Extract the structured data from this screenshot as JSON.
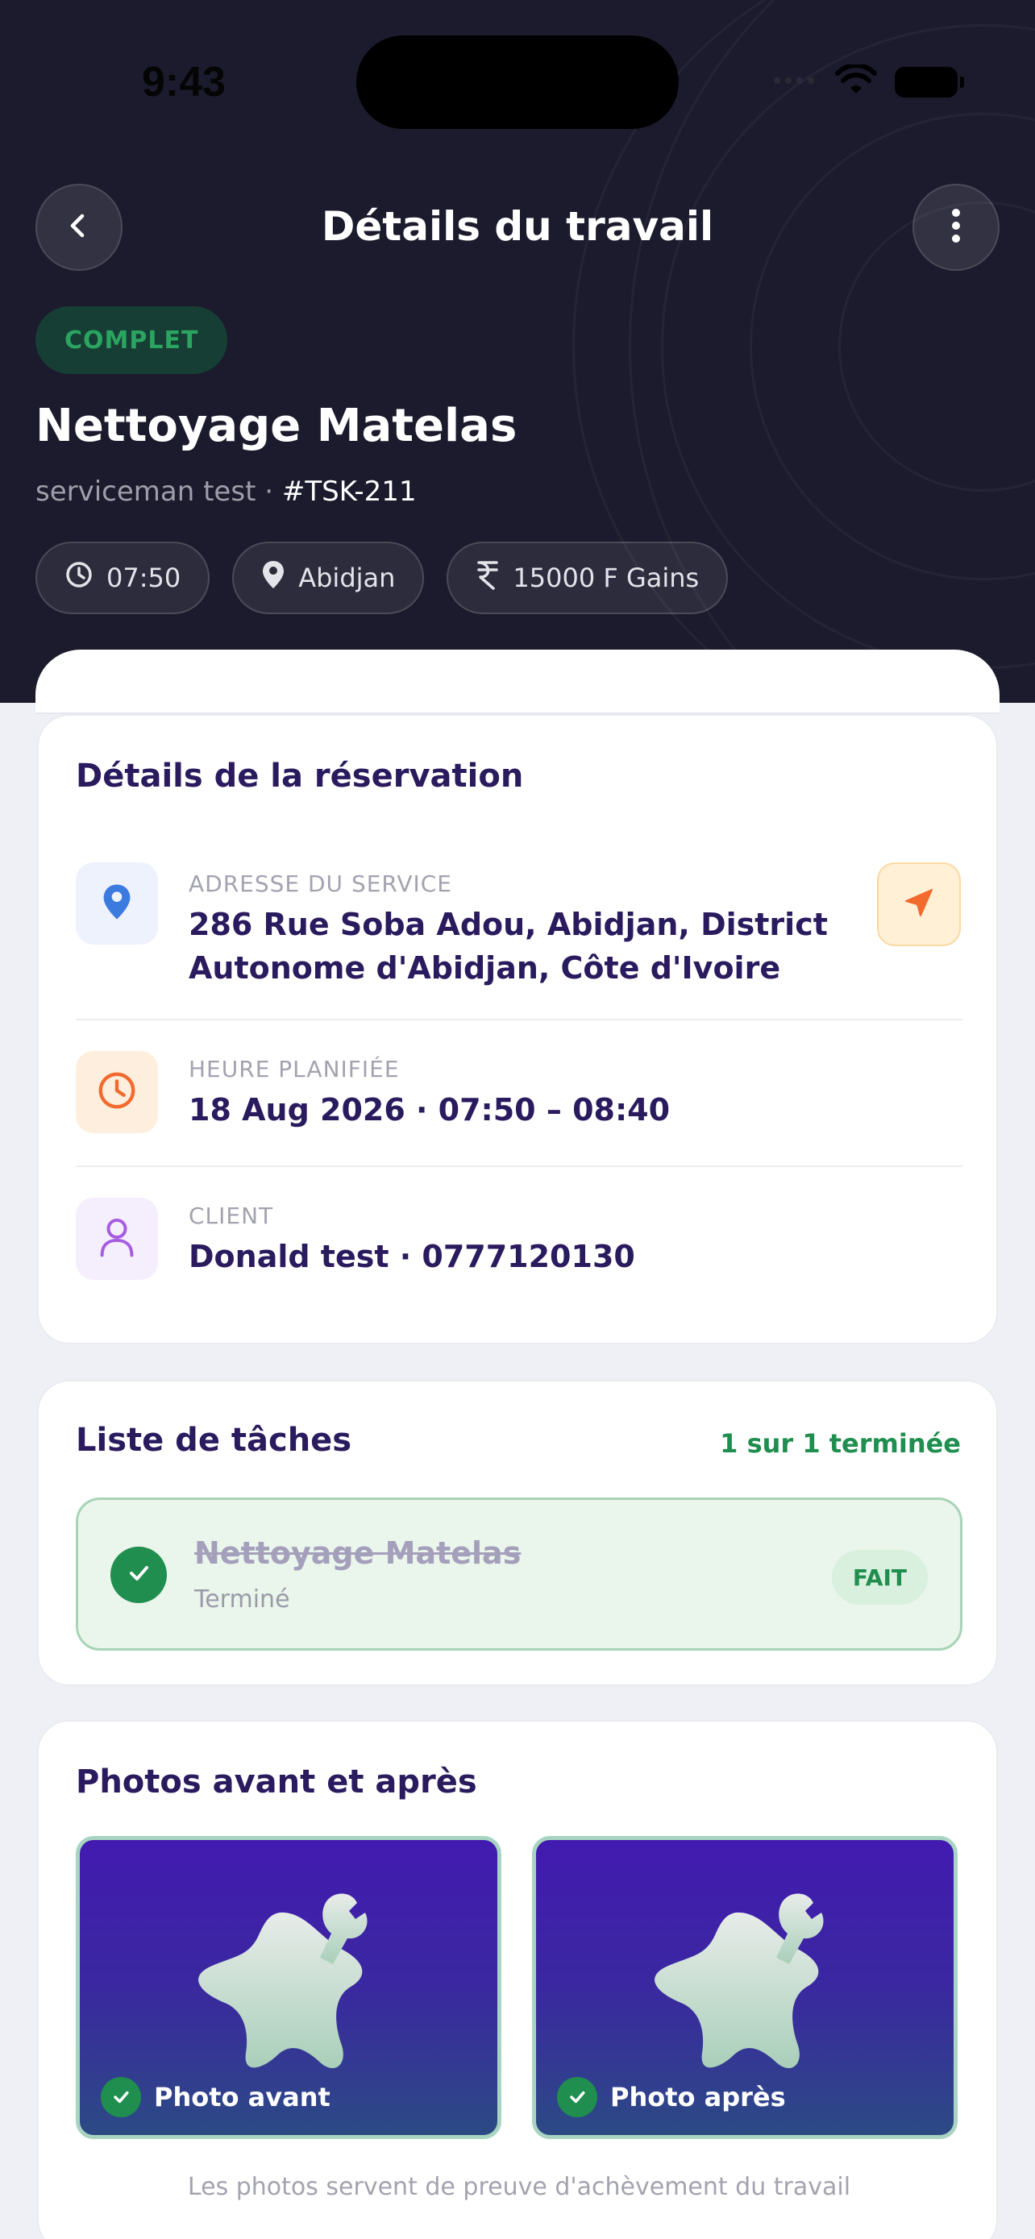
{
  "status_bar": {
    "time": "9:43"
  },
  "header": {
    "title": "Détails du travail",
    "status": "COMPLET",
    "job_title": "Nettoyage Matelas",
    "provider": "serviceman test",
    "separator": " · ",
    "reference": "#TSK-211",
    "chips": {
      "time": "07:50",
      "city": "Abidjan",
      "earnings": "15000 F Gains"
    }
  },
  "booking": {
    "title": "Détails de la réservation",
    "address_label": "ADRESSE DU SERVICE",
    "address_line1": "286 Rue Soba Adou, Abidjan, District",
    "address_line2": "Autonome d'Abidjan, Côte d'Ivoire",
    "schedule_label": "HEURE PLANIFIÉE",
    "schedule_value": "18 Aug 2026 · 07:50 – 08:40",
    "client_label": "CLIENT",
    "client_value": "Donald test · 0777120130"
  },
  "tasks": {
    "title": "Liste de tâches",
    "progress": "1 sur 1 terminée",
    "items": [
      {
        "name": "Nettoyage Matelas",
        "status": "Terminé",
        "badge": "FAIT"
      }
    ]
  },
  "photos": {
    "title": "Photos avant et après",
    "before_label": "Photo avant",
    "after_label": "Photo après",
    "footnote": "Les photos servent de preuve d'achèvement du travail"
  },
  "colors": {
    "header_bg": "#1c1b2d",
    "accent_green": "#1f8e4e",
    "title_purple": "#2a1a5e",
    "nav_orange": "#f26a2e"
  }
}
